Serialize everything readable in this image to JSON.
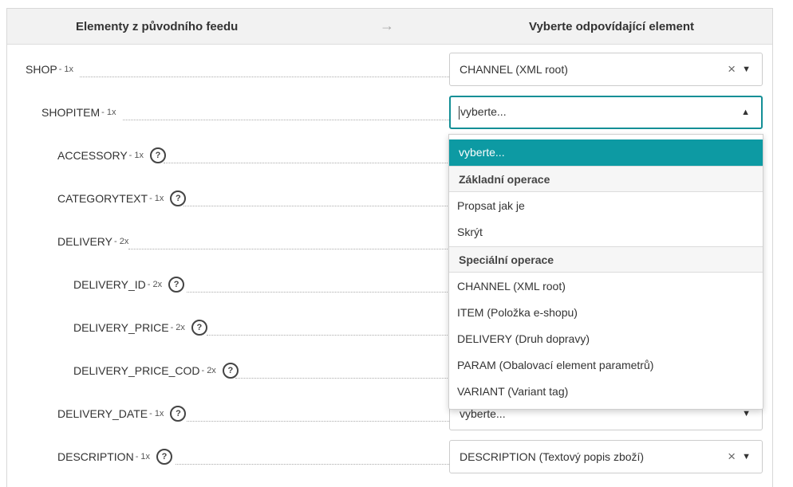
{
  "header": {
    "left_title": "Elementy z původního feedu",
    "arrow": "→",
    "right_title": "Vyberte odpovídající element"
  },
  "rows": [
    {
      "name": "SHOP",
      "count": "- 1x",
      "help": false,
      "value": "CHANNEL (XML root)",
      "clearable": true
    },
    {
      "name": "SHOPITEM",
      "count": "- 1x",
      "help": false,
      "value": "vyberte...",
      "clearable": false,
      "open": true
    },
    {
      "name": "ACCESSORY",
      "count": "- 1x",
      "help": true
    },
    {
      "name": "CATEGORYTEXT",
      "count": "- 1x",
      "help": true
    },
    {
      "name": "DELIVERY",
      "count": "- 2x",
      "help": false
    },
    {
      "name": "DELIVERY_ID",
      "count": "- 2x",
      "help": true
    },
    {
      "name": "DELIVERY_PRICE",
      "count": "- 2x",
      "help": true
    },
    {
      "name": "DELIVERY_PRICE_COD",
      "count": "- 2x",
      "help": true
    },
    {
      "name": "DELIVERY_DATE",
      "count": "- 1x",
      "help": true,
      "value": "vyberte...",
      "clearable": false
    },
    {
      "name": "DESCRIPTION",
      "count": "- 1x",
      "help": true,
      "value": "DESCRIPTION (Textový popis zboží)",
      "clearable": true
    }
  ],
  "help_glyph": "?",
  "clear_glyph": "×",
  "caret_down": "▼",
  "caret_up": "▲",
  "dropdown": {
    "selected_placeholder": "vyberte...",
    "group_basic": "Základní operace",
    "opt_copy": "Propsat jak je",
    "opt_hide": "Skrýt",
    "group_special": "Speciální operace",
    "opt_channel": "CHANNEL (XML root)",
    "opt_item": "ITEM (Položka e-shopu)",
    "opt_delivery": "DELIVERY (Druh dopravy)",
    "opt_param": "PARAM (Obalovací element parametrů)",
    "opt_variant": "VARIANT (Variant tag)"
  },
  "colors": {
    "accent": "#0d9aa3",
    "focus_border": "#138f96",
    "header_bg": "#f2f2f2"
  }
}
